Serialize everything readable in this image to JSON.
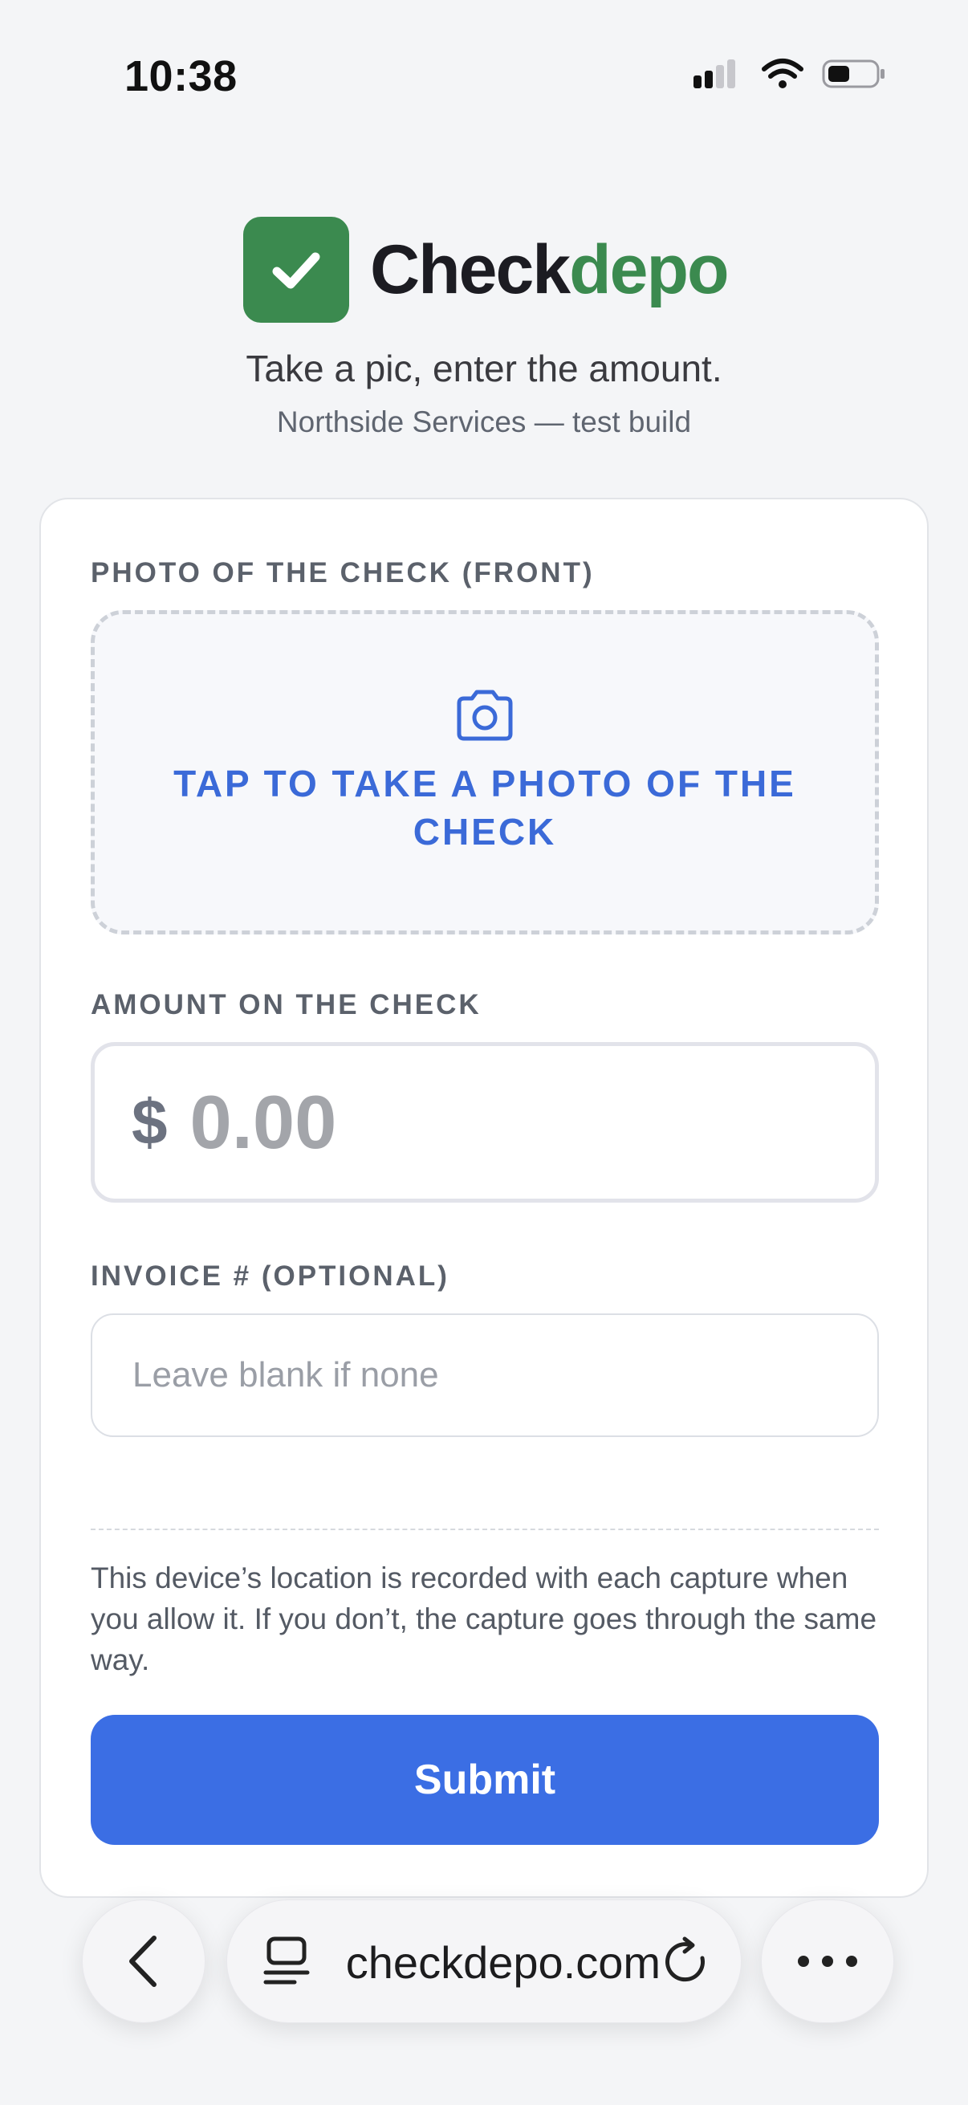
{
  "status_bar": {
    "time": "10:38"
  },
  "brand": {
    "name_part1": "Check",
    "name_part2": "depo",
    "primary_color": "#3b8a4f"
  },
  "header": {
    "tagline": "Take a pic, enter the amount.",
    "subtitle": "Northside Services — test build"
  },
  "form": {
    "photo_label": "PHOTO OF THE CHECK (FRONT)",
    "photo_prompt": "TAP TO TAKE A PHOTO OF THE CHECK",
    "amount_label": "AMOUNT ON THE CHECK",
    "amount_currency": "$",
    "amount_placeholder": "0.00",
    "invoice_label": "INVOICE # (OPTIONAL)",
    "invoice_placeholder": "Leave blank if none",
    "location_notice": "This device’s location is recorded with each capture when you allow it. If you don’t, the capture goes through the same way.",
    "submit_label": "Submit",
    "accent_color": "#3b6ee4"
  },
  "browser": {
    "url": "checkdepo.com",
    "icons": [
      "back-icon",
      "tabs-icon",
      "reload-icon",
      "more-icon"
    ]
  }
}
